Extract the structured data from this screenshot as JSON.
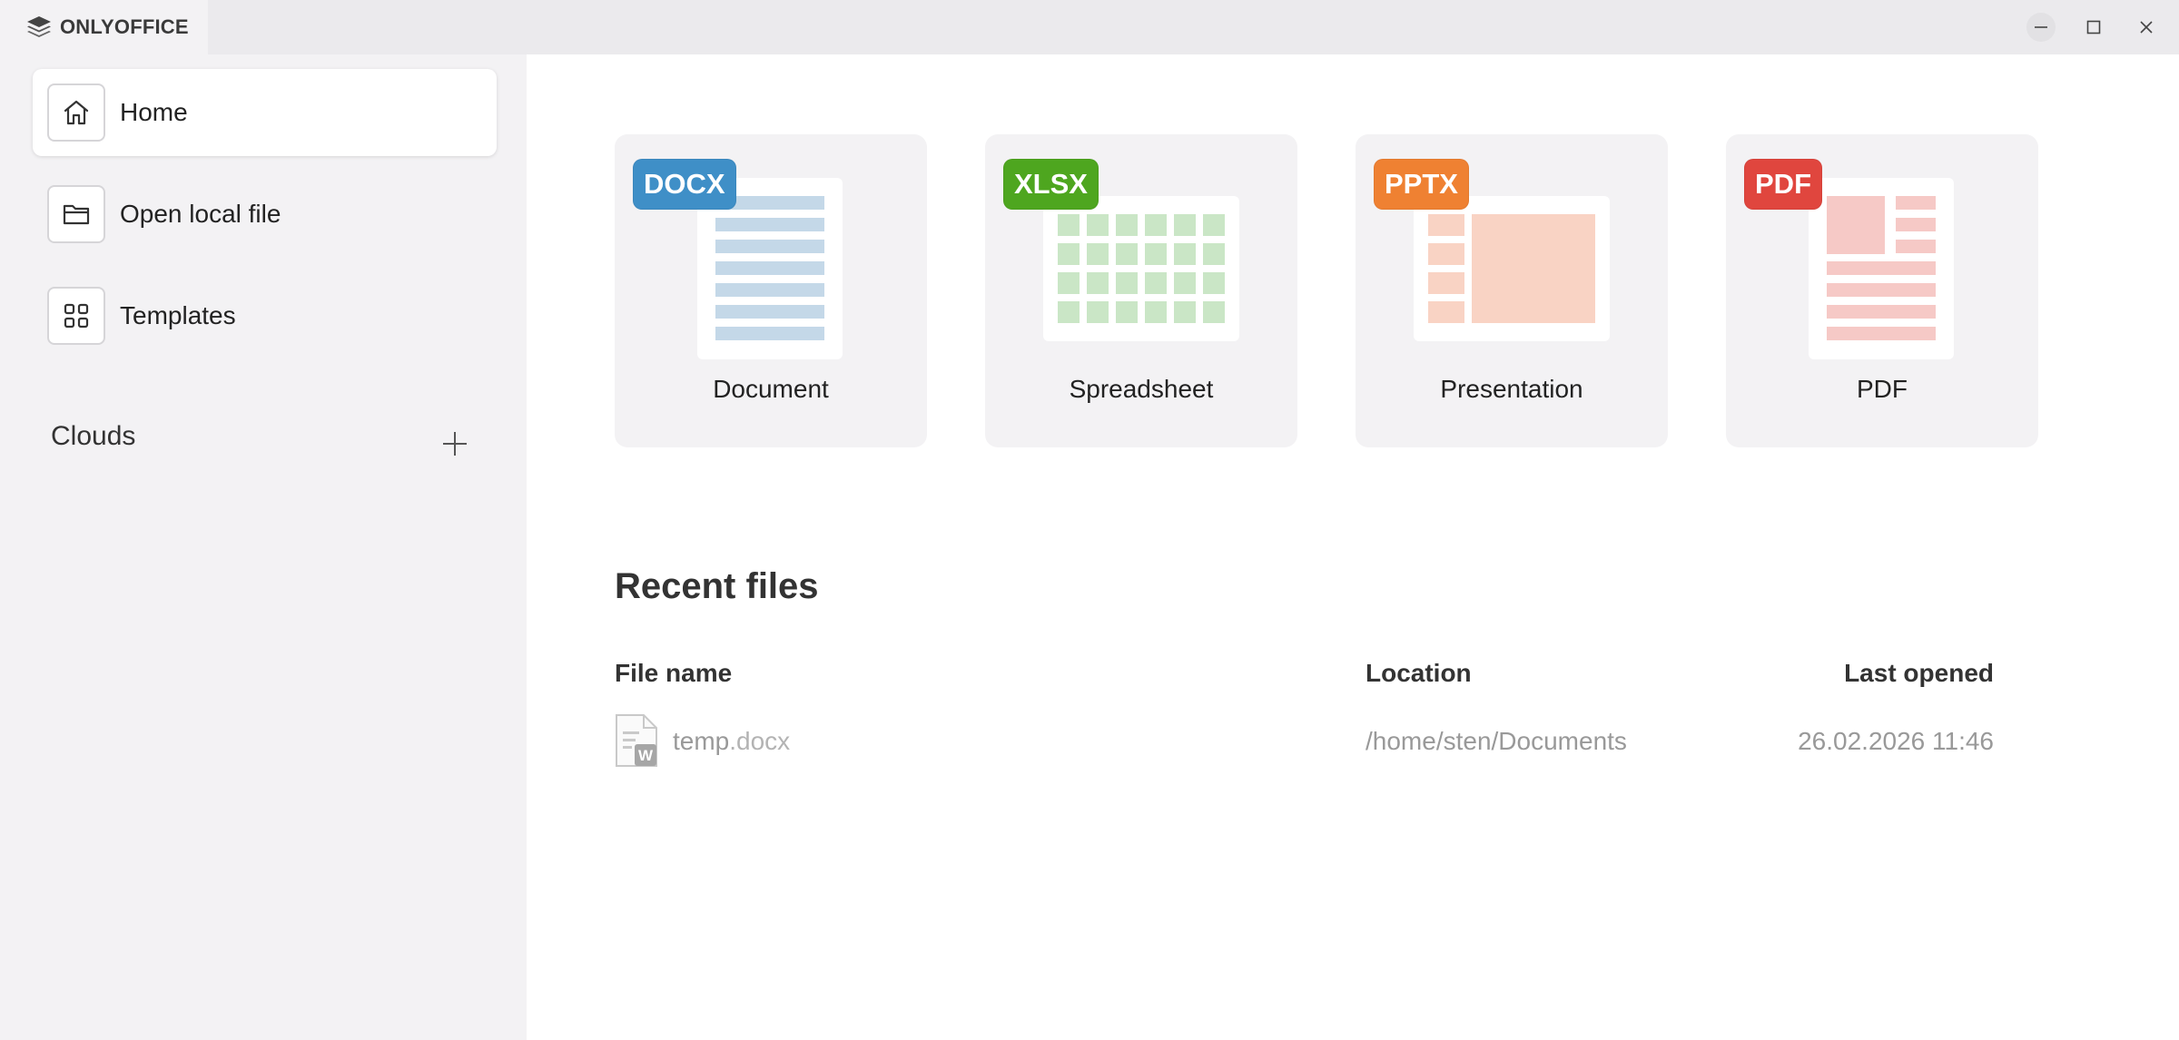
{
  "app": {
    "name": "ONLYOFFICE"
  },
  "window_controls": {
    "minimize": "minimize-icon",
    "maximize": "maximize-icon",
    "close": "close-icon"
  },
  "sidebar": {
    "items": [
      {
        "label": "Home",
        "icon": "home-icon",
        "active": true
      },
      {
        "label": "Open local file",
        "icon": "folder-icon",
        "active": false
      },
      {
        "label": "Templates",
        "icon": "grid-icon",
        "active": false
      }
    ],
    "clouds": {
      "title": "Clouds",
      "add_icon": "plus-icon"
    }
  },
  "create": {
    "tiles": [
      {
        "badge": "DOCX",
        "label": "Document",
        "color": "#3f8fc7"
      },
      {
        "badge": "XLSX",
        "label": "Spreadsheet",
        "color": "#4ea61f"
      },
      {
        "badge": "PPTX",
        "label": "Presentation",
        "color": "#ef8132"
      },
      {
        "badge": "PDF",
        "label": "PDF",
        "color": "#e0463e"
      }
    ]
  },
  "recent": {
    "title": "Recent files",
    "columns": {
      "name": "File name",
      "location": "Location",
      "last_opened": "Last opened"
    },
    "files": [
      {
        "name": "temp",
        "ext": ".docx",
        "location": "/home/sten/Documents",
        "last_opened": "26.02.2026 11:46"
      }
    ]
  }
}
